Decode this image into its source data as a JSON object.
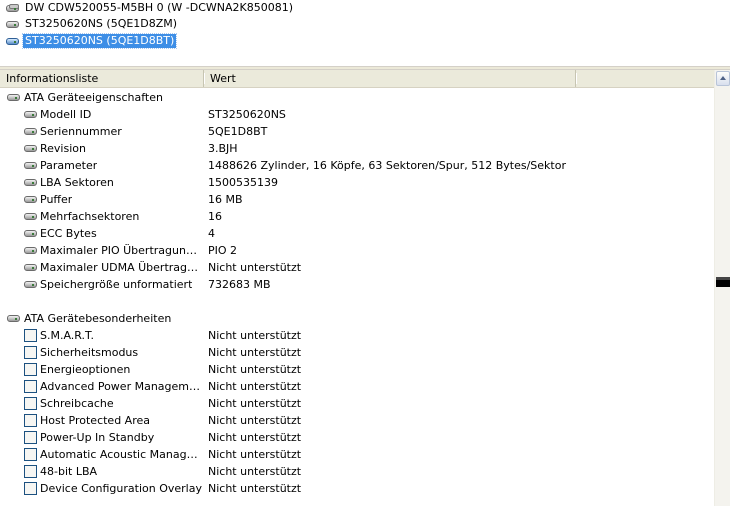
{
  "devices": [
    {
      "label": "DW CDW520055-M5BH 0 (W -DCWNA2K850081)",
      "icon": "optical-drive-icon",
      "selected": false
    },
    {
      "label": "ST3250620NS (5QE1D8ZM)",
      "icon": "hard-disk-icon",
      "selected": false
    },
    {
      "label": "ST3250620NS (5QE1D8BT)",
      "icon": "hard-disk-icon",
      "selected": true
    }
  ],
  "list": {
    "columns": [
      "Informationsliste",
      "Wert"
    ],
    "sections": [
      {
        "title": "ATA Geräteeigenschaften",
        "icon": "hard-disk-icon",
        "rows": [
          {
            "name": "Modell ID",
            "value": "ST3250620NS"
          },
          {
            "name": "Seriennummer",
            "value": "5QE1D8BT"
          },
          {
            "name": "Revision",
            "value": "3.BJH"
          },
          {
            "name": "Parameter",
            "value": "1488626 Zylinder, 16 Köpfe, 63 Sektoren/Spur, 512 Bytes/Sektor"
          },
          {
            "name": "LBA Sektoren",
            "value": "1500535139"
          },
          {
            "name": "Puffer",
            "value": "16 MB"
          },
          {
            "name": "Mehrfachsektoren",
            "value": "16"
          },
          {
            "name": "ECC Bytes",
            "value": "4"
          },
          {
            "name": "Maximaler PIO Übertragungsm...",
            "value": "PIO 2"
          },
          {
            "name": "Maximaler UDMA Übertragung...",
            "value": "Nicht unterstützt"
          },
          {
            "name": "Speichergröße unformatiert",
            "value": "732683 MB"
          }
        ]
      },
      {
        "title": "ATA Gerätebesonderheiten",
        "icon": "hard-disk-icon",
        "rows": [
          {
            "name": "S.M.A.R.T.",
            "value": "Nicht unterstützt"
          },
          {
            "name": "Sicherheitsmodus",
            "value": "Nicht unterstützt"
          },
          {
            "name": "Energieoptionen",
            "value": "Nicht unterstützt"
          },
          {
            "name": "Advanced Power Management...",
            "value": "Nicht unterstützt"
          },
          {
            "name": "Schreibcache",
            "value": "Nicht unterstützt"
          },
          {
            "name": "Host Protected Area",
            "value": "Nicht unterstützt"
          },
          {
            "name": "Power-Up In Standby",
            "value": "Nicht unterstützt"
          },
          {
            "name": "Automatic Acoustic Management",
            "value": "Nicht unterstützt"
          },
          {
            "name": "48-bit LBA",
            "value": "Nicht unterstützt"
          },
          {
            "name": "Device Configuration Overlay",
            "value": "Nicht unterstützt"
          }
        ]
      }
    ]
  },
  "colors": {
    "selection": "#3d8ee6",
    "header": "#ebeadb"
  }
}
